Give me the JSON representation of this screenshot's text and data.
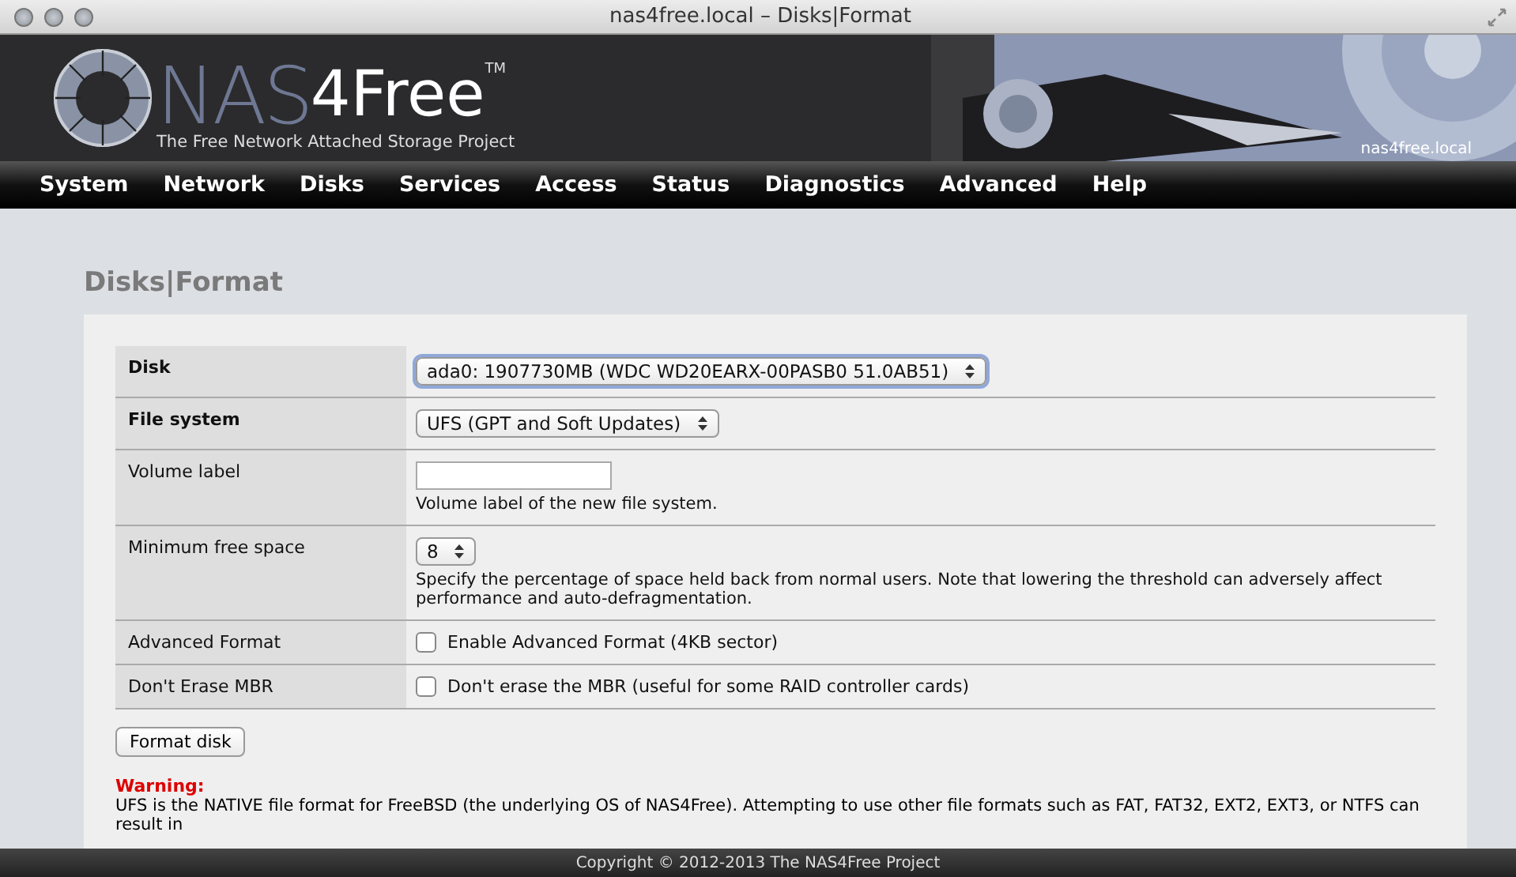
{
  "window": {
    "title": "nas4free.local – Disks|Format"
  },
  "header": {
    "logo": {
      "primary": "NAS",
      "secondary": "4Free",
      "mark": "TM",
      "tagline": "The Free Network Attached Storage Project"
    },
    "hostname": "nas4free.local"
  },
  "nav": [
    "System",
    "Network",
    "Disks",
    "Services",
    "Access",
    "Status",
    "Diagnostics",
    "Advanced",
    "Help"
  ],
  "page_title": "Disks|Format",
  "form": [
    {
      "label": "Disk",
      "required": true,
      "kind": "select",
      "value": "ada0: 1907730MB (WDC WD20EARX-00PASB0 51.0AB51)",
      "focused": true
    },
    {
      "label": "File system",
      "required": true,
      "kind": "select",
      "value": "UFS (GPT and Soft Updates)"
    },
    {
      "label": "Volume label",
      "required": false,
      "kind": "input",
      "hint": "Volume label of the new file system."
    },
    {
      "label": "Minimum free space",
      "required": false,
      "kind": "select",
      "value": "8",
      "hint": "Specify the percentage of space held back from normal users. Note that lowering the threshold can adversely affect performance and auto-defragmentation."
    },
    {
      "label": "Advanced Format",
      "required": false,
      "kind": "checkbox",
      "checked": false,
      "text": "Enable Advanced Format (4KB sector)"
    },
    {
      "label": "Don't Erase MBR",
      "required": false,
      "kind": "checkbox",
      "checked": false,
      "text": "Don't erase the MBR (useful for some RAID controller cards)"
    }
  ],
  "button": "Format disk",
  "warning": {
    "title": "Warning:",
    "text": "UFS is the NATIVE file format for FreeBSD (the underlying OS of NAS4Free). Attempting to use other file formats such as FAT, FAT32, EXT2, EXT3, or NTFS can result in"
  },
  "footer": "Copyright © 2012-2013 The NAS4Free Project"
}
